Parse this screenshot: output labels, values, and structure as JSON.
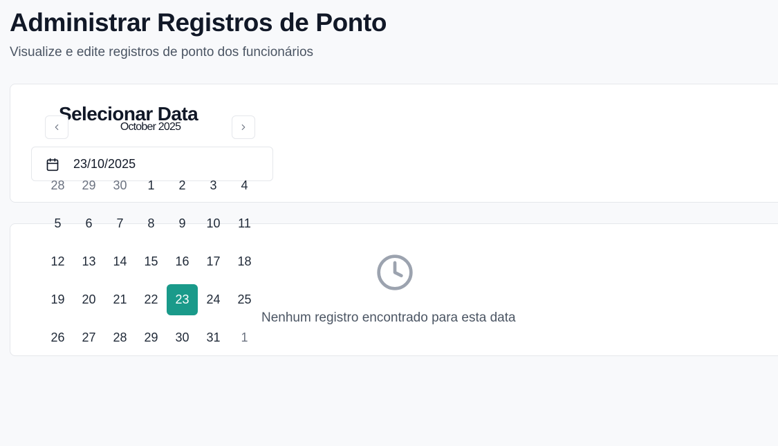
{
  "header": {
    "title": "Administrar Registros de Ponto",
    "subtitle": "Visualize e edite registros de ponto dos funcionários"
  },
  "date_picker": {
    "heading": "Selecionar Data",
    "month_label": "October 2025",
    "selected_value": "23/10/2025",
    "prev_icon": "chevron-left-icon",
    "next_icon": "chevron-right-icon",
    "input_icon": "calendar-icon",
    "accent_color": "#1a9a8a",
    "weeks": [
      [
        {
          "d": "28",
          "out": true
        },
        {
          "d": "29",
          "out": true
        },
        {
          "d": "30",
          "out": true
        },
        {
          "d": "1"
        },
        {
          "d": "2"
        },
        {
          "d": "3"
        },
        {
          "d": "4"
        }
      ],
      [
        {
          "d": "5"
        },
        {
          "d": "6"
        },
        {
          "d": "7"
        },
        {
          "d": "8"
        },
        {
          "d": "9"
        },
        {
          "d": "10"
        },
        {
          "d": "11"
        }
      ],
      [
        {
          "d": "12"
        },
        {
          "d": "13"
        },
        {
          "d": "14"
        },
        {
          "d": "15"
        },
        {
          "d": "16"
        },
        {
          "d": "17"
        },
        {
          "d": "18"
        }
      ],
      [
        {
          "d": "19"
        },
        {
          "d": "20"
        },
        {
          "d": "21"
        },
        {
          "d": "22"
        },
        {
          "d": "23",
          "selected": true
        },
        {
          "d": "24"
        },
        {
          "d": "25"
        }
      ],
      [
        {
          "d": "26"
        },
        {
          "d": "27"
        },
        {
          "d": "28"
        },
        {
          "d": "29"
        },
        {
          "d": "30"
        },
        {
          "d": "31"
        },
        {
          "d": "1",
          "out": true
        }
      ]
    ]
  },
  "records": {
    "empty_icon": "clock-icon",
    "empty_message": "Nenhum registro encontrado para esta data"
  }
}
